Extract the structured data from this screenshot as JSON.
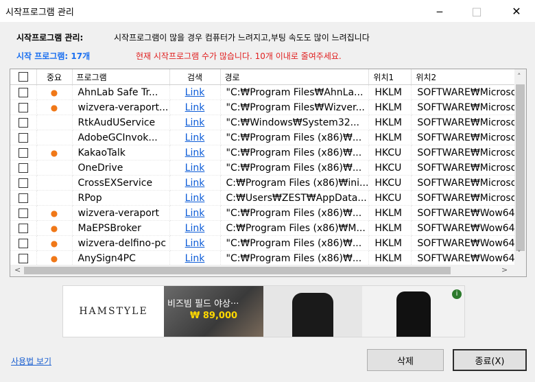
{
  "window": {
    "title": "시작프로그램 관리",
    "minimize": "‒",
    "maximize": "□",
    "close": "✕"
  },
  "info": {
    "label": "시작프로그램 관리:",
    "text": "시작프로그램이 많을 경우 컴퓨터가 느려지고,부팅 속도도 많이 느려집니다",
    "count": "시작 프로그램: 17개",
    "warning": "현재 시작프로그램 수가 많습니다. 10개 이내로 줄여주세요."
  },
  "table": {
    "headers": {
      "importance": "중요",
      "program": "프로그램",
      "search": "검색",
      "path": "경로",
      "loc1": "위치1",
      "loc2": "위치2"
    },
    "rows": [
      {
        "important": "●",
        "program": "AhnLab Safe Tr...",
        "search": "Link",
        "path": "\"C:₩Program Files₩AhnLa...",
        "loc1": "HKLM",
        "loc2": "SOFTWARE₩Microso"
      },
      {
        "important": "●",
        "program": "wizvera-veraport...",
        "search": "Link",
        "path": "\"C:₩Program Files₩Wizver...",
        "loc1": "HKLM",
        "loc2": "SOFTWARE₩Microso"
      },
      {
        "important": "",
        "program": "RtkAudUService",
        "search": "Link",
        "path": "\"C:₩Windows₩System32...",
        "loc1": "HKLM",
        "loc2": "SOFTWARE₩Microso"
      },
      {
        "important": "",
        "program": "AdobeGCInvok...",
        "search": "Link",
        "path": "\"C:₩Program Files (x86)₩...",
        "loc1": "HKLM",
        "loc2": "SOFTWARE₩Microso"
      },
      {
        "important": "●",
        "program": "KakaoTalk",
        "search": "Link",
        "path": "\"C:₩Program Files (x86)₩...",
        "loc1": "HKCU",
        "loc2": "SOFTWARE₩Microso"
      },
      {
        "important": "",
        "program": "OneDrive",
        "search": "Link",
        "path": "\"C:₩Program Files (x86)₩...",
        "loc1": "HKCU",
        "loc2": "SOFTWARE₩Microso"
      },
      {
        "important": "",
        "program": "CrossEXService",
        "search": "Link",
        "path": "C:₩Program Files (x86)₩ini...",
        "loc1": "HKCU",
        "loc2": "SOFTWARE₩Microso"
      },
      {
        "important": "",
        "program": "RPop",
        "search": "Link",
        "path": "C:₩Users₩ZEST₩AppData...",
        "loc1": "HKCU",
        "loc2": "SOFTWARE₩Microso"
      },
      {
        "important": "●",
        "program": "wizvera-veraport",
        "search": "Link",
        "path": "\"C:₩Program Files (x86)₩...",
        "loc1": "HKLM",
        "loc2": "SOFTWARE₩Wow64"
      },
      {
        "important": "●",
        "program": "MaEPSBroker",
        "search": "Link",
        "path": "C:₩Program Files (x86)₩M...",
        "loc1": "HKLM",
        "loc2": "SOFTWARE₩Wow64"
      },
      {
        "important": "●",
        "program": "wizvera-delfino-pc",
        "search": "Link",
        "path": "\"C:₩Program Files (x86)₩...",
        "loc1": "HKLM",
        "loc2": "SOFTWARE₩Wow64"
      },
      {
        "important": "●",
        "program": "AnySign4PC",
        "search": "Link",
        "path": "\"C:₩Program Files (x86)₩...",
        "loc1": "HKLM",
        "loc2": "SOFTWARE₩Wow64"
      }
    ]
  },
  "ad": {
    "brand": "HAMSTYLE",
    "product": "비즈빔 필드 야상···",
    "price": "₩ 89,000",
    "info_icon": "i"
  },
  "footer": {
    "help": "사용법 보기",
    "delete": "삭제",
    "exit": "종료(X)"
  },
  "colors": {
    "warning": "#e02020",
    "count": "#1a6ff0",
    "dot": "#f07818",
    "link": "#0b5bd7"
  }
}
